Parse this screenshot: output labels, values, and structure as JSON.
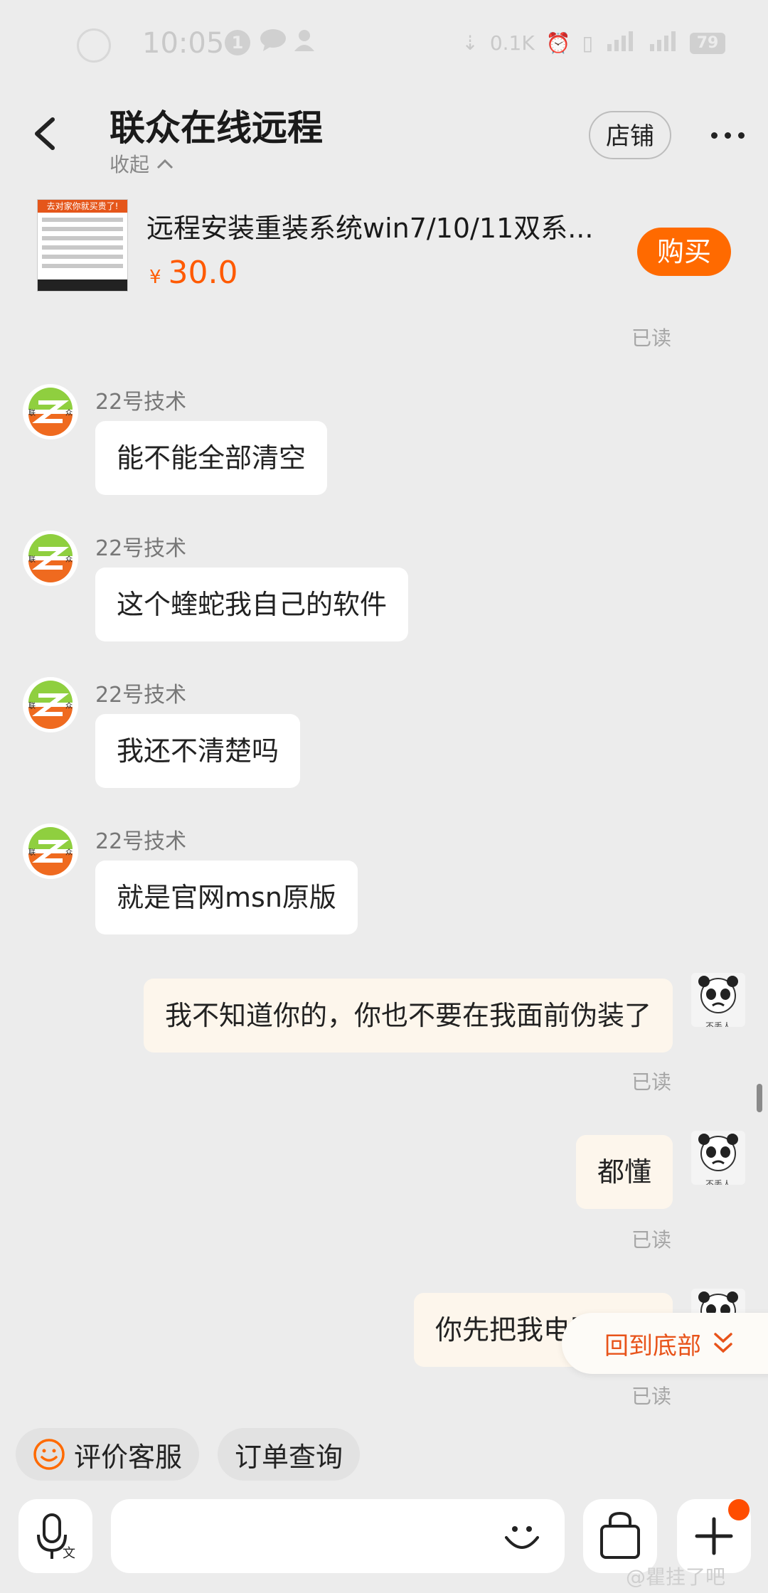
{
  "status_bar": {
    "time": "10:05",
    "notification_count": "1",
    "network_speed": "0.1K",
    "battery": "79"
  },
  "header": {
    "title": "联众在线远程",
    "collapse_label": "收起",
    "shop_button": "店铺"
  },
  "product": {
    "thumbnail_banner": "去对家你就买贵了!",
    "name": "远程安装重装系统win7/10/11双系...",
    "currency": "¥",
    "price": "30.0",
    "buy_button": "购买"
  },
  "messages": [
    {
      "type": "read",
      "text": "已读"
    },
    {
      "type": "incoming",
      "sender": "22号技术",
      "text": "能不能全部清空"
    },
    {
      "type": "incoming",
      "sender": "22号技术",
      "text": "这个蝰蛇我自己的软件"
    },
    {
      "type": "incoming",
      "sender": "22号技术",
      "text": "我还不清楚吗"
    },
    {
      "type": "incoming",
      "sender": "22号技术",
      "text": "就是官网msn原版"
    },
    {
      "type": "outgoing",
      "text": "我不知道你的，你也不要在我面前伪装了",
      "read": "已读"
    },
    {
      "type": "outgoing",
      "text": "都懂",
      "read": "已读"
    },
    {
      "type": "outgoing",
      "text": "你先把我电脑搞好",
      "read": "已读"
    }
  ],
  "avatar_seller_text": {
    "left": "联",
    "right": "众"
  },
  "avatar_user_caption": "不丢人",
  "back_to_bottom": "回到底部",
  "quick_replies": [
    "评价客服",
    "订单查询"
  ],
  "watermark": "@瞿挂了吧",
  "colors": {
    "accent": "#ff6a00",
    "price": "#ff5a00",
    "back_to_bottom": "#e8531a"
  }
}
